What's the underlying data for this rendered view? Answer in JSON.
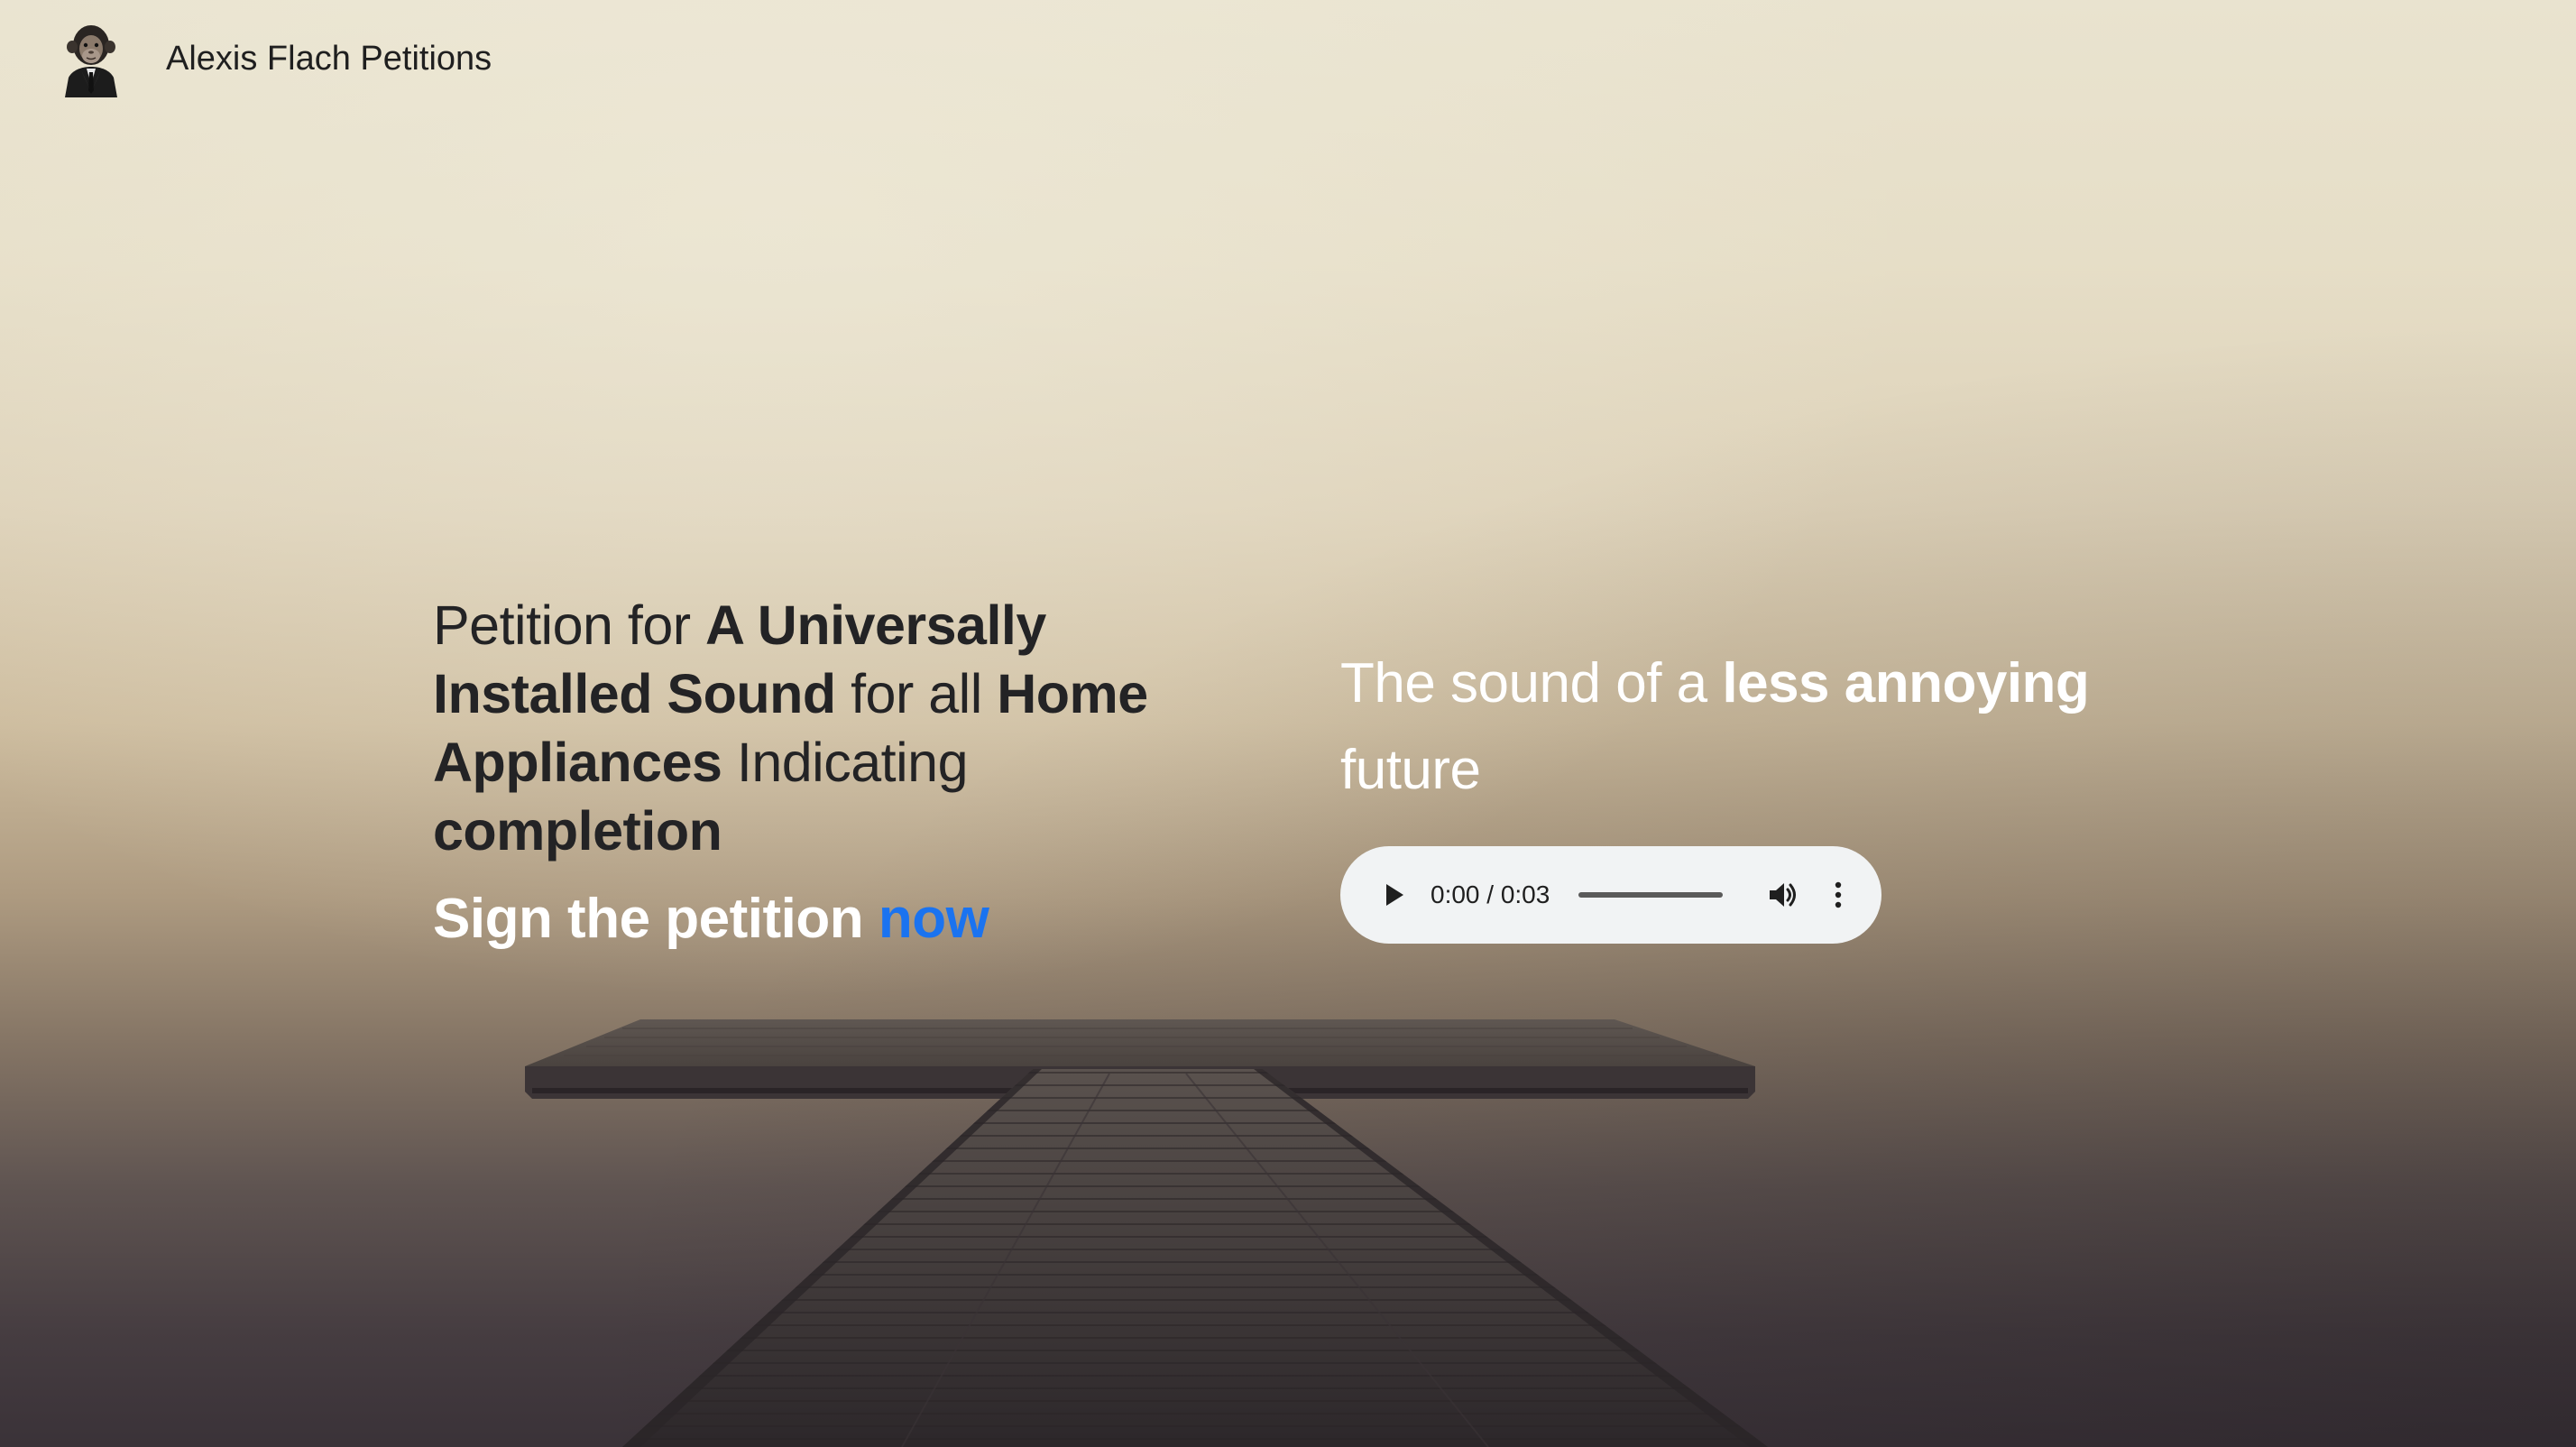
{
  "header": {
    "brand": "Alexis Flach Petitions",
    "logo_icon": "chimp-in-suit-avatar"
  },
  "hero": {
    "headline_parts": [
      {
        "text": "Petition for ",
        "bold": false
      },
      {
        "text": "A Universally Installed Sound",
        "bold": true
      },
      {
        "text": " for all ",
        "bold": false
      },
      {
        "text": "Home Appliances",
        "bold": true
      },
      {
        "text": " Indicating ",
        "bold": false
      },
      {
        "text": "completion",
        "bold": true
      }
    ],
    "cta_prefix": "Sign the petition ",
    "cta_link": "now",
    "cta_link_color": "#1a73f0"
  },
  "sound": {
    "prefix": "The sound of a ",
    "emphasis": "less annoying",
    "suffix": " future"
  },
  "player": {
    "time": "0:00 / 0:03",
    "progress": 0,
    "icons": [
      "play-icon",
      "volume-icon",
      "more-vert-icon"
    ]
  }
}
